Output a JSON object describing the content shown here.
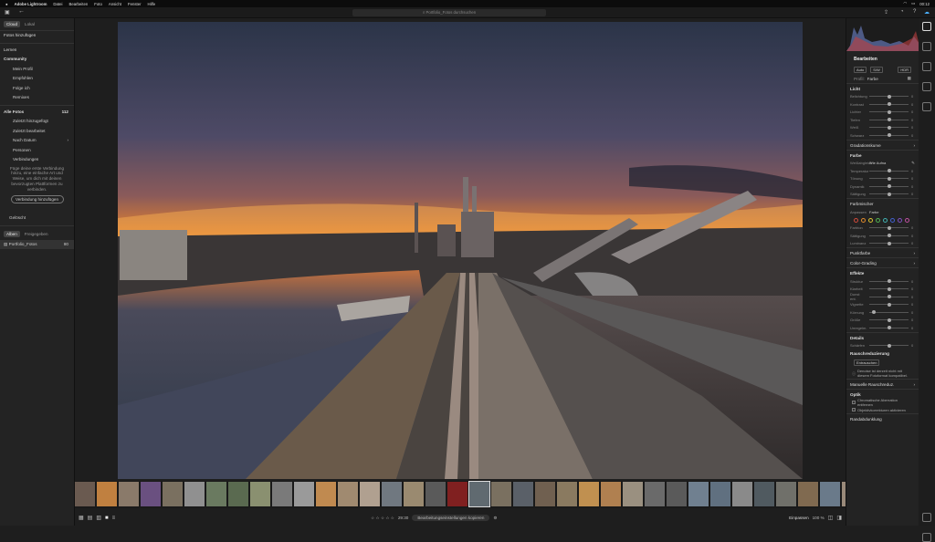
{
  "menubar": {
    "apple": "",
    "app": "Adobe Lightroom",
    "items": [
      "Datei",
      "Bearbeiten",
      "Foto",
      "Ansicht",
      "Fenster",
      "Hilfe"
    ],
    "time": "00:12"
  },
  "toolbar": {
    "search_placeholder": "Portfolio_Fotos durchsuchen"
  },
  "left": {
    "tabs": [
      "Cloud",
      "Lokal"
    ],
    "add_photos": "Fotos hinzufügen",
    "learn": "Lernen",
    "community": "Community",
    "community_items": [
      "Mein Profil",
      "Empfohlen",
      "Folge ich",
      "Remixes"
    ],
    "all_photos": "Alle Fotos",
    "all_count": "112",
    "library_items": [
      {
        "label": "Zuletzt hinzugefügt",
        "count": ""
      },
      {
        "label": "Zuletzt bearbeitet",
        "count": ""
      },
      {
        "label": "Nach Datum",
        "count": "›"
      },
      {
        "label": "Personen",
        "count": ""
      },
      {
        "label": "Verbindungen",
        "count": ""
      }
    ],
    "connections_note": "Füge deine erste Verbindung hinzu, eine einfache Art und Weise, um dich mit deinen bevorzugten Plattformen zu verbinden.",
    "add_connection": "Verbindung hinzufügen",
    "deleted": "Gelöscht",
    "album_tabs": [
      "Alben",
      "Freigegeben"
    ],
    "album_name": "Portfolio_Fotos",
    "album_count": "80"
  },
  "right": {
    "title": "Bearbeiten",
    "mode_buttons": [
      "Auto",
      "S/W",
      "HDR"
    ],
    "profile_label": "Profil:",
    "profile_value": "Farbe",
    "licht": "Licht",
    "licht_sliders": [
      {
        "label": "Belichtung",
        "pos": 0.5
      },
      {
        "label": "Kontrast",
        "pos": 0.5
      },
      {
        "label": "Lichter",
        "pos": 0.5
      },
      {
        "label": "Tiefen",
        "pos": 0.5
      },
      {
        "label": "Weiß",
        "pos": 0.5
      },
      {
        "label": "Schwarz",
        "pos": 0.5
      }
    ],
    "tonkurve": "Gradationskurve",
    "farbe": "Farbe",
    "wb_label": "Weißabgleich",
    "wb_value": "Wie Aufna",
    "farbe_sliders": [
      {
        "label": "Temperatur",
        "pos": 0.5
      },
      {
        "label": "Tönung",
        "pos": 0.5
      },
      {
        "label": "Dynamik",
        "pos": 0.5
      },
      {
        "label": "Sättigung",
        "pos": 0.5
      }
    ],
    "farbmischer": "Farbmischer",
    "fm_adjust_label": "Anpassen",
    "fm_adjust_value": "Farbe",
    "fm_colors": [
      "#d04a3a",
      "#e08a2a",
      "#d8c030",
      "#50b050",
      "#40b0b0",
      "#4060d0",
      "#8050c0",
      "#c050a0"
    ],
    "fm_sliders": [
      {
        "label": "Farbton",
        "pos": 0.5
      },
      {
        "label": "Sättigung",
        "pos": 0.5
      },
      {
        "label": "Luminanz",
        "pos": 0.5
      }
    ],
    "punktfarbe": "Punktfarbe",
    "color_grading": "Color-Grading",
    "effekte": "Effekte",
    "effekte_sliders": [
      {
        "label": "Struktur",
        "pos": 0.5
      },
      {
        "label": "Klarheit",
        "pos": 0.5
      },
      {
        "label": "Dunst ent.",
        "pos": 0.5
      },
      {
        "label": "Vignette",
        "pos": 0.5
      },
      {
        "label": "Körnung",
        "pos": 0.1
      },
      {
        "label": "Größe",
        "pos": 0.5
      },
      {
        "label": "Unregelm.",
        "pos": 0.5
      }
    ],
    "details": "Details",
    "details_sliders": [
      {
        "label": "Schärfen",
        "pos": 0.5
      }
    ],
    "noise": "Rauschreduzierung",
    "noise_button": "Entrauschen",
    "noise_note": "Denoise ist derzeit nicht mit diesem Fotoformat kompatibel.",
    "manual_noise": "Manuelle Rauschreduz.",
    "optik": "Optik",
    "optik_checks": [
      "Chromatische Aberration entfernen",
      "Objektivkorrekturen aktivieren"
    ],
    "randabdunklung": "Randabdunklung"
  },
  "bottom": {
    "ratio": "29:30",
    "reset_label": "Bearbeitungseinstellungen kopieren",
    "fit": "Einpassen",
    "zoom": "100 %"
  },
  "filmstrip_colors": [
    "#6a5a50",
    "#c08040",
    "#8a7a6a",
    "#6a5080",
    "#7a7060",
    "#909090",
    "#6a7a60",
    "#5a6a50",
    "#8a9070",
    "#7a7a7a",
    "#9a9a9a",
    "#c08a50",
    "#a08a70",
    "#b0a090",
    "#707880",
    "#9a8a70",
    "#5a5a5a",
    "#802020",
    "#606a70",
    "#7a7060",
    "#5a6068",
    "#706050",
    "#8a7a60",
    "#c09050",
    "#b08050",
    "#9a9080",
    "#6a6a6a",
    "#5a5a5a",
    "#708090",
    "#607080",
    "#8a8a8a",
    "#505a60",
    "#70706a",
    "#806a50",
    "#6a7a8a",
    "#9a8a7a",
    "#5a5060"
  ]
}
